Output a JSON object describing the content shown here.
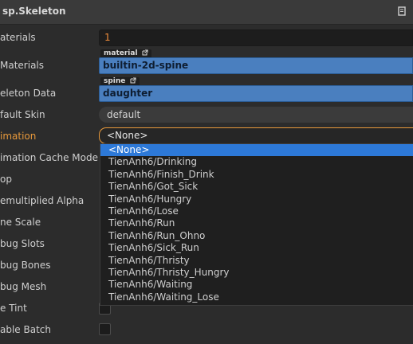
{
  "header": {
    "title": "sp.Skeleton",
    "book_icon": "book-icon"
  },
  "rows": {
    "materials": {
      "label": "aterials",
      "value": "1"
    },
    "custom_materials": {
      "label": "Materials",
      "tag": "material",
      "value": "builtin-2d-spine"
    },
    "skeleton_data": {
      "label": "eleton Data",
      "tag": "spine",
      "value": "daughter"
    },
    "default_skin": {
      "label": "fault Skin",
      "value": "default"
    },
    "animation": {
      "label": "imation",
      "value": "<None>"
    },
    "animation_cache_mode": {
      "label": "imation Cache Mode"
    },
    "loop": {
      "label": "op"
    },
    "premultiplied_alpha": {
      "label": "emultiplied Alpha"
    },
    "time_scale": {
      "label": "ne Scale"
    },
    "debug_slots": {
      "label": "bug Slots"
    },
    "debug_bones": {
      "label": "bug Bones"
    },
    "debug_mesh": {
      "label": "bug Mesh"
    },
    "use_tint": {
      "label": "e Tint"
    },
    "enable_batch": {
      "label": "able Batch"
    }
  },
  "dropdown": {
    "options": [
      "<None>",
      "TienAnh6/Drinking",
      "TienAnh6/Finish_Drink",
      "TienAnh6/Got_Sick",
      "TienAnh6/Hungry",
      "TienAnh6/Lose",
      "TienAnh6/Run",
      "TienAnh6/Run_Ohno",
      "TienAnh6/Sick_Run",
      "TienAnh6/Thristy",
      "TienAnh6/Thristy_Hungry",
      "TienAnh6/Waiting",
      "TienAnh6/Waiting_Lose"
    ],
    "selected_index": 0
  },
  "colors": {
    "accent_orange": "#e8993b",
    "asset_blue": "#4a7fbf",
    "selection_blue": "#2d79d8"
  }
}
